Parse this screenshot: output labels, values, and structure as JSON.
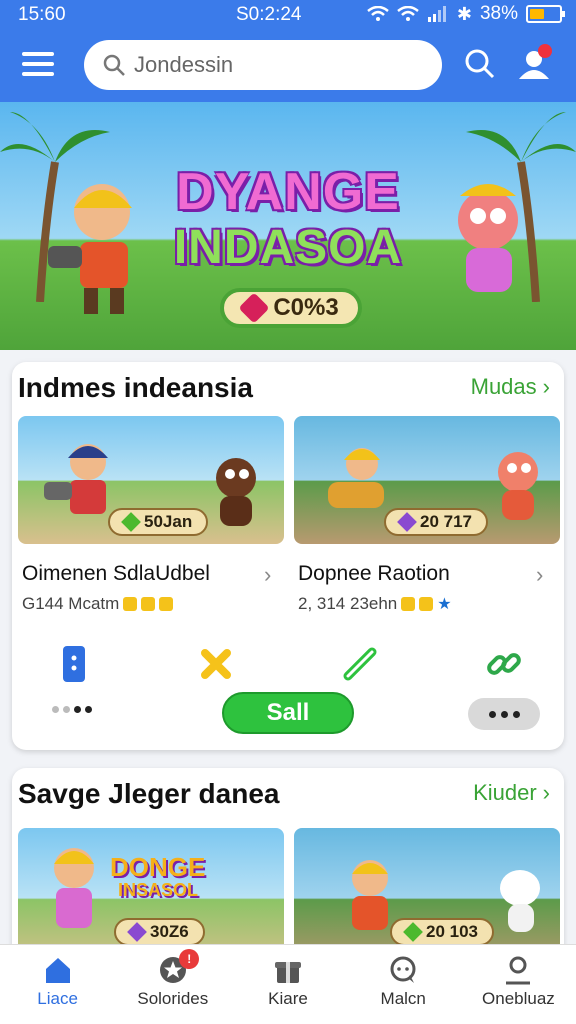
{
  "status": {
    "time": "15:60",
    "center": "S0:2:24",
    "battery": "38%"
  },
  "appbar": {
    "search_value": "Jondessin"
  },
  "hero": {
    "title_line1": "DYANGE",
    "title_line2": "INDASOA",
    "coin_value": "C0%3"
  },
  "section1": {
    "title": "Indmes indeansia",
    "link": "Mudas",
    "items": [
      {
        "pill_value": "50Jan",
        "name": "Oimenen SdlaUdbel",
        "meta": "G144 Mcatm"
      },
      {
        "pill_value": "20 717",
        "name": "Dopnee Raotion",
        "meta": "2, 314 23ehn"
      }
    ],
    "sell_label": "Sall"
  },
  "section2": {
    "title": "Savge Jleger danea",
    "link": "Kiuder",
    "items": [
      {
        "pill_value": "30Z6",
        "art_title1": "DONGE",
        "art_title2": "INSASOL"
      },
      {
        "pill_value": "20 103"
      }
    ]
  },
  "bottomnav": {
    "items": [
      {
        "label": "Liace",
        "icon": "home-icon"
      },
      {
        "label": "Solorides",
        "icon": "star-badge-icon",
        "badge": "!"
      },
      {
        "label": "Kiare",
        "icon": "gift-icon"
      },
      {
        "label": "Malcn",
        "icon": "chat-icon"
      },
      {
        "label": "Onebluaz",
        "icon": "profile-icon"
      }
    ]
  },
  "colors": {
    "primary": "#3b7bea",
    "accent_green": "#2ec23e",
    "link_green": "#3aa336"
  }
}
